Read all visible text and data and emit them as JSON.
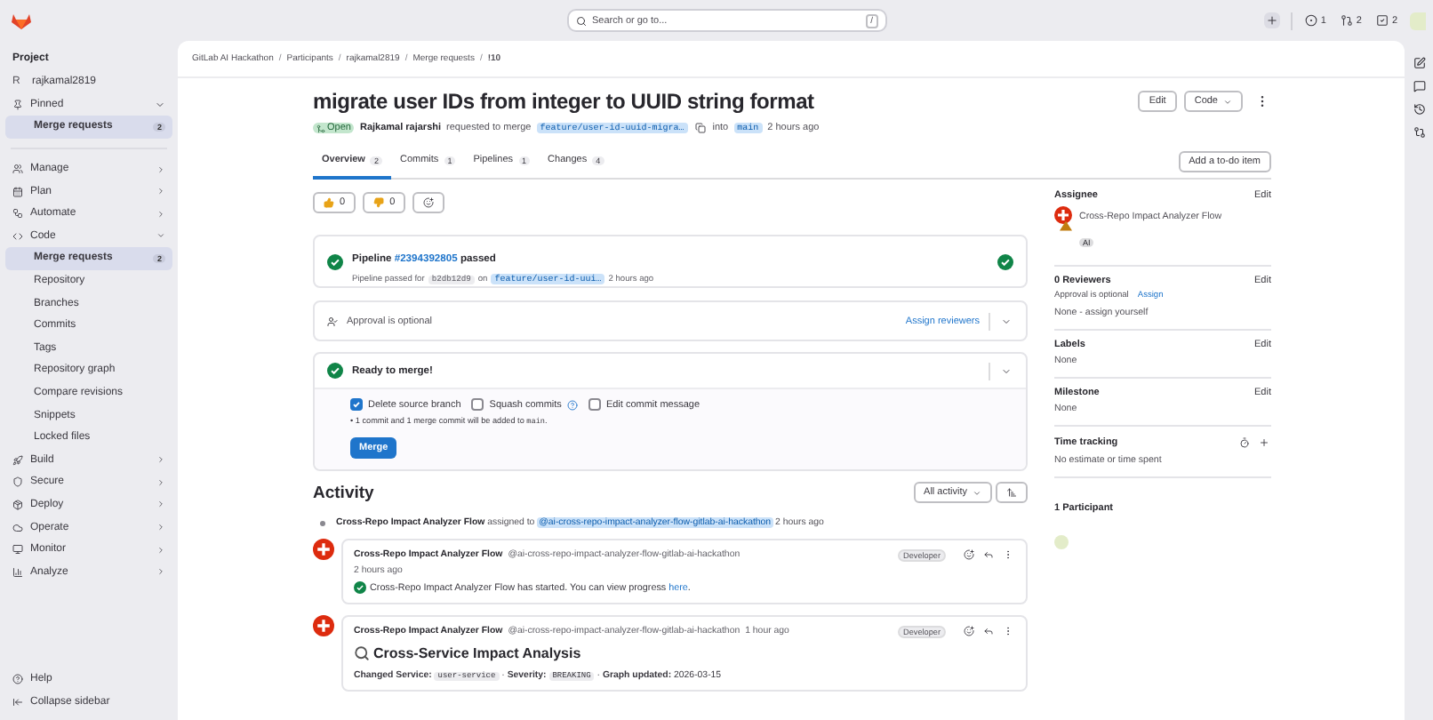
{
  "top_bar": {
    "search": {
      "placeholder": "Search or go to...",
      "shortcut": "/"
    },
    "counters": [
      {
        "kind": "issues",
        "count": "1"
      },
      {
        "kind": "merge_requests",
        "count": "2"
      },
      {
        "kind": "todos",
        "count": "2"
      }
    ]
  },
  "sidebar": {
    "title": "Project",
    "project": {
      "initial": "R",
      "name": "rajkamal2819"
    },
    "pinned": {
      "label": "Pinned",
      "expanded": true,
      "items": [
        {
          "label": "Merge requests",
          "count": "2",
          "selected": true
        }
      ]
    },
    "nav": [
      {
        "label": "Manage",
        "expanded": false
      },
      {
        "label": "Plan",
        "expanded": false
      },
      {
        "label": "Automate",
        "expanded": false
      },
      {
        "label": "Code",
        "expanded": true,
        "children": [
          {
            "label": "Merge requests",
            "count": "2",
            "selected": true
          },
          {
            "label": "Repository",
            "selected": false
          },
          {
            "label": "Branches",
            "selected": false
          },
          {
            "label": "Commits",
            "selected": false
          },
          {
            "label": "Tags",
            "selected": false
          },
          {
            "label": "Repository graph",
            "selected": false
          },
          {
            "label": "Compare revisions",
            "selected": false
          },
          {
            "label": "Snippets",
            "selected": false
          },
          {
            "label": "Locked files",
            "selected": false
          }
        ]
      },
      {
        "label": "Build",
        "expanded": false
      },
      {
        "label": "Secure",
        "expanded": false
      },
      {
        "label": "Deploy",
        "expanded": false
      },
      {
        "label": "Operate",
        "expanded": false
      },
      {
        "label": "Monitor",
        "expanded": false
      },
      {
        "label": "Analyze",
        "expanded": false
      }
    ],
    "footer": [
      {
        "kind": "help",
        "label": "Help"
      },
      {
        "kind": "collapse",
        "label": "Collapse sidebar"
      }
    ]
  },
  "breadcrumbs": {
    "separator": "/",
    "items": [
      "GitLab AI Hackathon",
      "Participants",
      "rajkamal2819",
      "Merge requests",
      "!10"
    ]
  },
  "merge_request": {
    "title": "migrate user IDs from integer to UUID string format",
    "status": "Open",
    "author": "Rajkamal rajarshi",
    "action": "requested to merge",
    "source_branch": "feature/user-id-uuid-migra…",
    "into": "into",
    "target_branch": "main",
    "time": "2 hours ago",
    "buttons": {
      "edit": "Edit",
      "code": "Code"
    },
    "tabs": [
      {
        "label": "Overview",
        "count": "2",
        "selected": true
      },
      {
        "label": "Commits",
        "count": "1",
        "selected": false
      },
      {
        "label": "Pipelines",
        "count": "1",
        "selected": false
      },
      {
        "label": "Changes",
        "count": "4",
        "selected": false
      }
    ],
    "todo_button": "Add a to-do item"
  },
  "reactions": [
    {
      "kind": "thumbs_up",
      "count": "0"
    },
    {
      "kind": "thumbs_down",
      "count": "0"
    }
  ],
  "pipeline": {
    "label": "Pipeline",
    "id": "#2394392805",
    "status": "passed",
    "detail_prefix": "Pipeline passed for",
    "commit": "b2db12d9",
    "joiner": "on",
    "branch": "feature/user-id-uui…",
    "time": "2 hours ago"
  },
  "approval": {
    "text": "Approval is optional",
    "action": "Assign reviewers"
  },
  "merge_widget": {
    "title": "Ready to merge!",
    "options": [
      {
        "label": "Delete source branch",
        "checked": true,
        "help": false
      },
      {
        "label": "Squash commits",
        "checked": false,
        "help": true
      },
      {
        "label": "Edit commit message",
        "checked": false,
        "help": false
      }
    ],
    "note": {
      "bullet": "•",
      "before": "1 commit and 1 merge commit will be added to",
      "code": "main",
      "after": "."
    },
    "button": "Merge"
  },
  "activity": {
    "title": "Activity",
    "filter": "All activity",
    "system_note": {
      "actor": "Cross-Repo Impact Analyzer Flow",
      "action": "assigned to",
      "mention": "@ai-cross-repo-impact-analyzer-flow-gitlab-ai-hackathon",
      "time": "2 hours ago"
    },
    "comments": [
      {
        "kind": "status",
        "author": "Cross-Repo Impact Analyzer Flow",
        "handle": "@ai-cross-repo-impact-analyzer-flow-gitlab-ai-hackathon",
        "time": "2 hours ago",
        "role": "Developer",
        "body": {
          "text": "Cross-Repo Impact Analyzer Flow has started. You can view progress",
          "link": "here",
          "after": "."
        }
      },
      {
        "kind": "report",
        "author": "Cross-Repo Impact Analyzer Flow",
        "handle": "@ai-cross-repo-impact-analyzer-flow-gitlab-ai-hackathon",
        "time": "1 hour ago",
        "role": "Developer",
        "heading": "Cross-Service Impact Analysis",
        "separator": "·",
        "facts": [
          {
            "label": "Changed Service:",
            "value": "user-service",
            "kind": "code"
          },
          {
            "label": "Severity:",
            "value": "BREAKING",
            "kind": "code"
          },
          {
            "label": "Graph updated:",
            "value": "2026-03-15",
            "kind": "text"
          }
        ]
      }
    ]
  },
  "details": {
    "assignee": {
      "title": "Assignee",
      "edit": "Edit",
      "name": "Cross-Repo Impact Analyzer Flow",
      "badge": "AI"
    },
    "reviewers": {
      "title": "0 Reviewers",
      "edit": "Edit",
      "note": "Approval is optional",
      "action": "Assign",
      "empty": "None - assign yourself"
    },
    "labels": {
      "title": "Labels",
      "edit": "Edit",
      "value": "None"
    },
    "milestone": {
      "title": "Milestone",
      "edit": "Edit",
      "value": "None"
    },
    "time_tracking": {
      "title": "Time tracking",
      "value": "No estimate or time spent"
    },
    "participants": {
      "title": "1 Participant"
    }
  }
}
